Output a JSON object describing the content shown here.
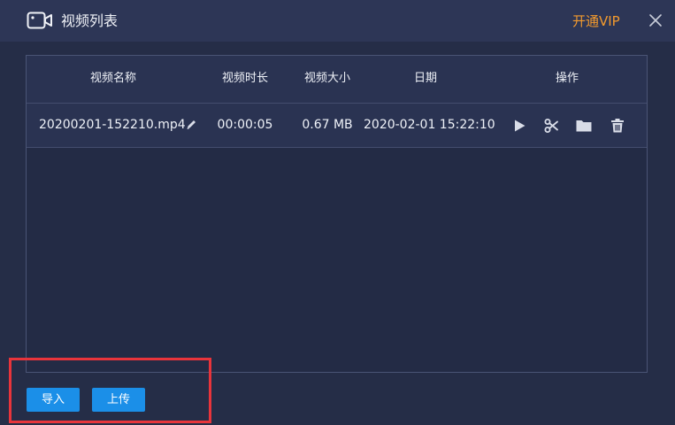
{
  "window": {
    "title": "视频列表",
    "vip_label": "开通VIP"
  },
  "table": {
    "headers": {
      "name": "视频名称",
      "duration": "视频时长",
      "size": "视频大小",
      "date": "日期",
      "actions": "操作"
    },
    "rows": [
      {
        "name": "20200201-152210.mp4",
        "duration": "00:00:05",
        "size": "0.67 MB",
        "date": "2020-02-01 15:22:10"
      }
    ]
  },
  "footer": {
    "import_label": "导入",
    "upload_label": "上传"
  },
  "icons": {
    "title": "video-camera-icon",
    "close": "close-icon",
    "edit": "pencil-icon",
    "play": "play-icon",
    "cut": "scissors-icon",
    "folder": "folder-icon",
    "delete": "trash-icon"
  },
  "colors": {
    "background": "#252d47",
    "titlebar": "#2d3656",
    "vip": "#f29a2e",
    "button": "#1b8fe8",
    "highlight": "#e8343b"
  }
}
